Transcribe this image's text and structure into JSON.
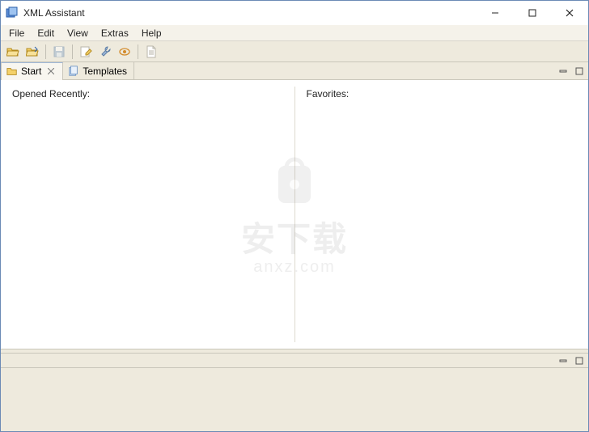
{
  "window": {
    "title": "XML Assistant"
  },
  "menu": {
    "file": "File",
    "edit": "Edit",
    "view": "View",
    "extras": "Extras",
    "help": "Help"
  },
  "toolbar": {
    "icons": {
      "open": "open-folder-icon",
      "open_alt": "open-folder-alt-icon",
      "save": "save-icon",
      "save_disabled": true,
      "edit": "edit-page-icon",
      "wrench": "wrench-icon",
      "eye": "eye-icon",
      "document": "document-icon"
    }
  },
  "tabs": {
    "start": {
      "label": "Start"
    },
    "templates": {
      "label": "Templates"
    }
  },
  "panes": {
    "recent": "Opened Recently:",
    "favorites": "Favorites:"
  },
  "watermark": {
    "top": "安下载",
    "sub": "anxz.com"
  }
}
